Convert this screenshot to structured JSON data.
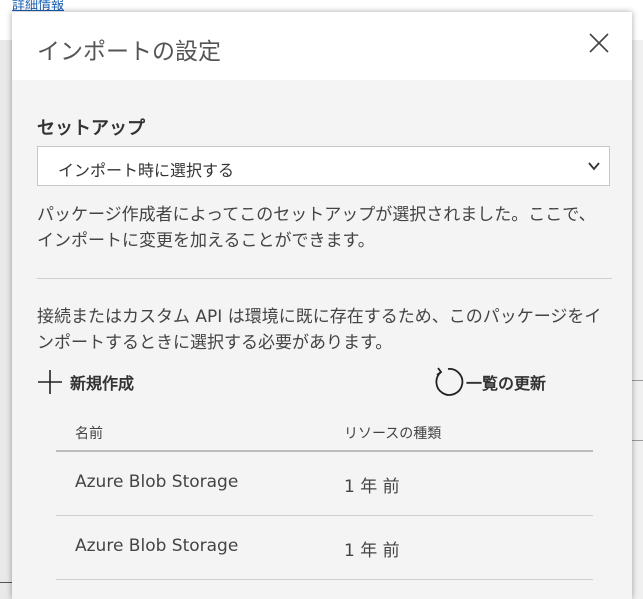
{
  "background": {
    "link_text": "詳細情報"
  },
  "dialog": {
    "title": "インポートの設定",
    "close_icon": "close-icon",
    "setup": {
      "label": "セットアップ",
      "selected_value": "インポート時に選択する",
      "options": [
        "インポート時に選択する"
      ]
    },
    "setup_description": "パッケージ作成者によってこのセットアップが選択されました。ここで、インポートに変更を加えることができます。",
    "connection_description": "接続またはカスタム API は環境に既に存在するため、このパッケージをインポートするときに選択する必要があります。",
    "actions": {
      "new_label": "新規作成",
      "new_icon": "plus-icon",
      "refresh_label": "一覧の更新",
      "refresh_icon": "refresh-icon"
    },
    "table": {
      "headers": [
        "名前",
        "リソースの種類"
      ],
      "rows": [
        [
          "Azure Blob Storage",
          "1 年 前"
        ],
        [
          "Azure Blob Storage",
          "1 年 前"
        ]
      ]
    }
  },
  "colors": {
    "dialog_bg": "#f4f4f4",
    "header_bg": "#ffffff",
    "text": "#444444",
    "link": "#1a5fb4"
  }
}
